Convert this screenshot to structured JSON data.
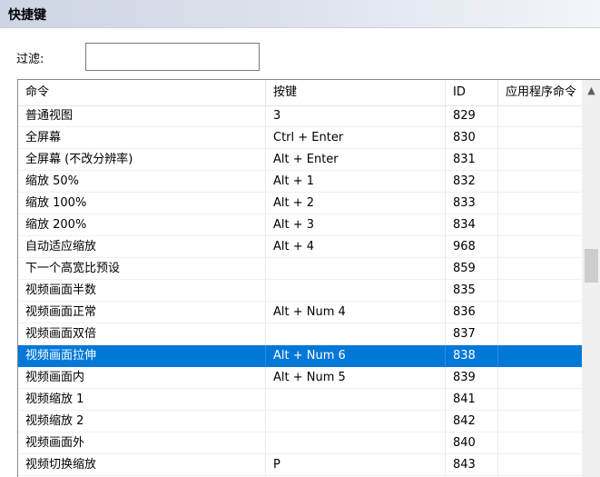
{
  "window": {
    "title": "快捷键"
  },
  "filter": {
    "label": "过滤:",
    "value": ""
  },
  "table": {
    "columns": [
      "命令",
      "按键",
      "ID",
      "应用程序命令"
    ],
    "rows": [
      {
        "command": "普通视图",
        "keys": "3",
        "id": "829",
        "app_command": "",
        "selected": false
      },
      {
        "command": "全屏幕",
        "keys": "Ctrl + Enter",
        "id": "830",
        "app_command": "",
        "selected": false
      },
      {
        "command": "全屏幕 (不改分辨率)",
        "keys": "Alt + Enter",
        "id": "831",
        "app_command": "",
        "selected": false
      },
      {
        "command": "缩放 50%",
        "keys": "Alt + 1",
        "id": "832",
        "app_command": "",
        "selected": false
      },
      {
        "command": "缩放 100%",
        "keys": "Alt + 2",
        "id": "833",
        "app_command": "",
        "selected": false
      },
      {
        "command": "缩放 200%",
        "keys": "Alt + 3",
        "id": "834",
        "app_command": "",
        "selected": false
      },
      {
        "command": "自动适应缩放",
        "keys": "Alt + 4",
        "id": "968",
        "app_command": "",
        "selected": false
      },
      {
        "command": "下一个高宽比预设",
        "keys": "",
        "id": "859",
        "app_command": "",
        "selected": false
      },
      {
        "command": "视频画面半数",
        "keys": "",
        "id": "835",
        "app_command": "",
        "selected": false
      },
      {
        "command": "视频画面正常",
        "keys": "Alt + Num 4",
        "id": "836",
        "app_command": "",
        "selected": false
      },
      {
        "command": "视频画面双倍",
        "keys": "",
        "id": "837",
        "app_command": "",
        "selected": false
      },
      {
        "command": "视频画面拉伸",
        "keys": "Alt + Num 6",
        "id": "838",
        "app_command": "",
        "selected": true
      },
      {
        "command": "视频画面内",
        "keys": "Alt + Num 5",
        "id": "839",
        "app_command": "",
        "selected": false
      },
      {
        "command": "视频缩放 1",
        "keys": "",
        "id": "841",
        "app_command": "",
        "selected": false
      },
      {
        "command": "视频缩放 2",
        "keys": "",
        "id": "842",
        "app_command": "",
        "selected": false
      },
      {
        "command": "视频画面外",
        "keys": "",
        "id": "840",
        "app_command": "",
        "selected": false
      },
      {
        "command": "视频切换缩放",
        "keys": "P",
        "id": "843",
        "app_command": "",
        "selected": false
      }
    ]
  },
  "scrollbar": {
    "position": 0.43,
    "visible_fraction": 0.09
  },
  "colors": {
    "selection": "#0078d7",
    "selection_text": "#ffffff"
  }
}
